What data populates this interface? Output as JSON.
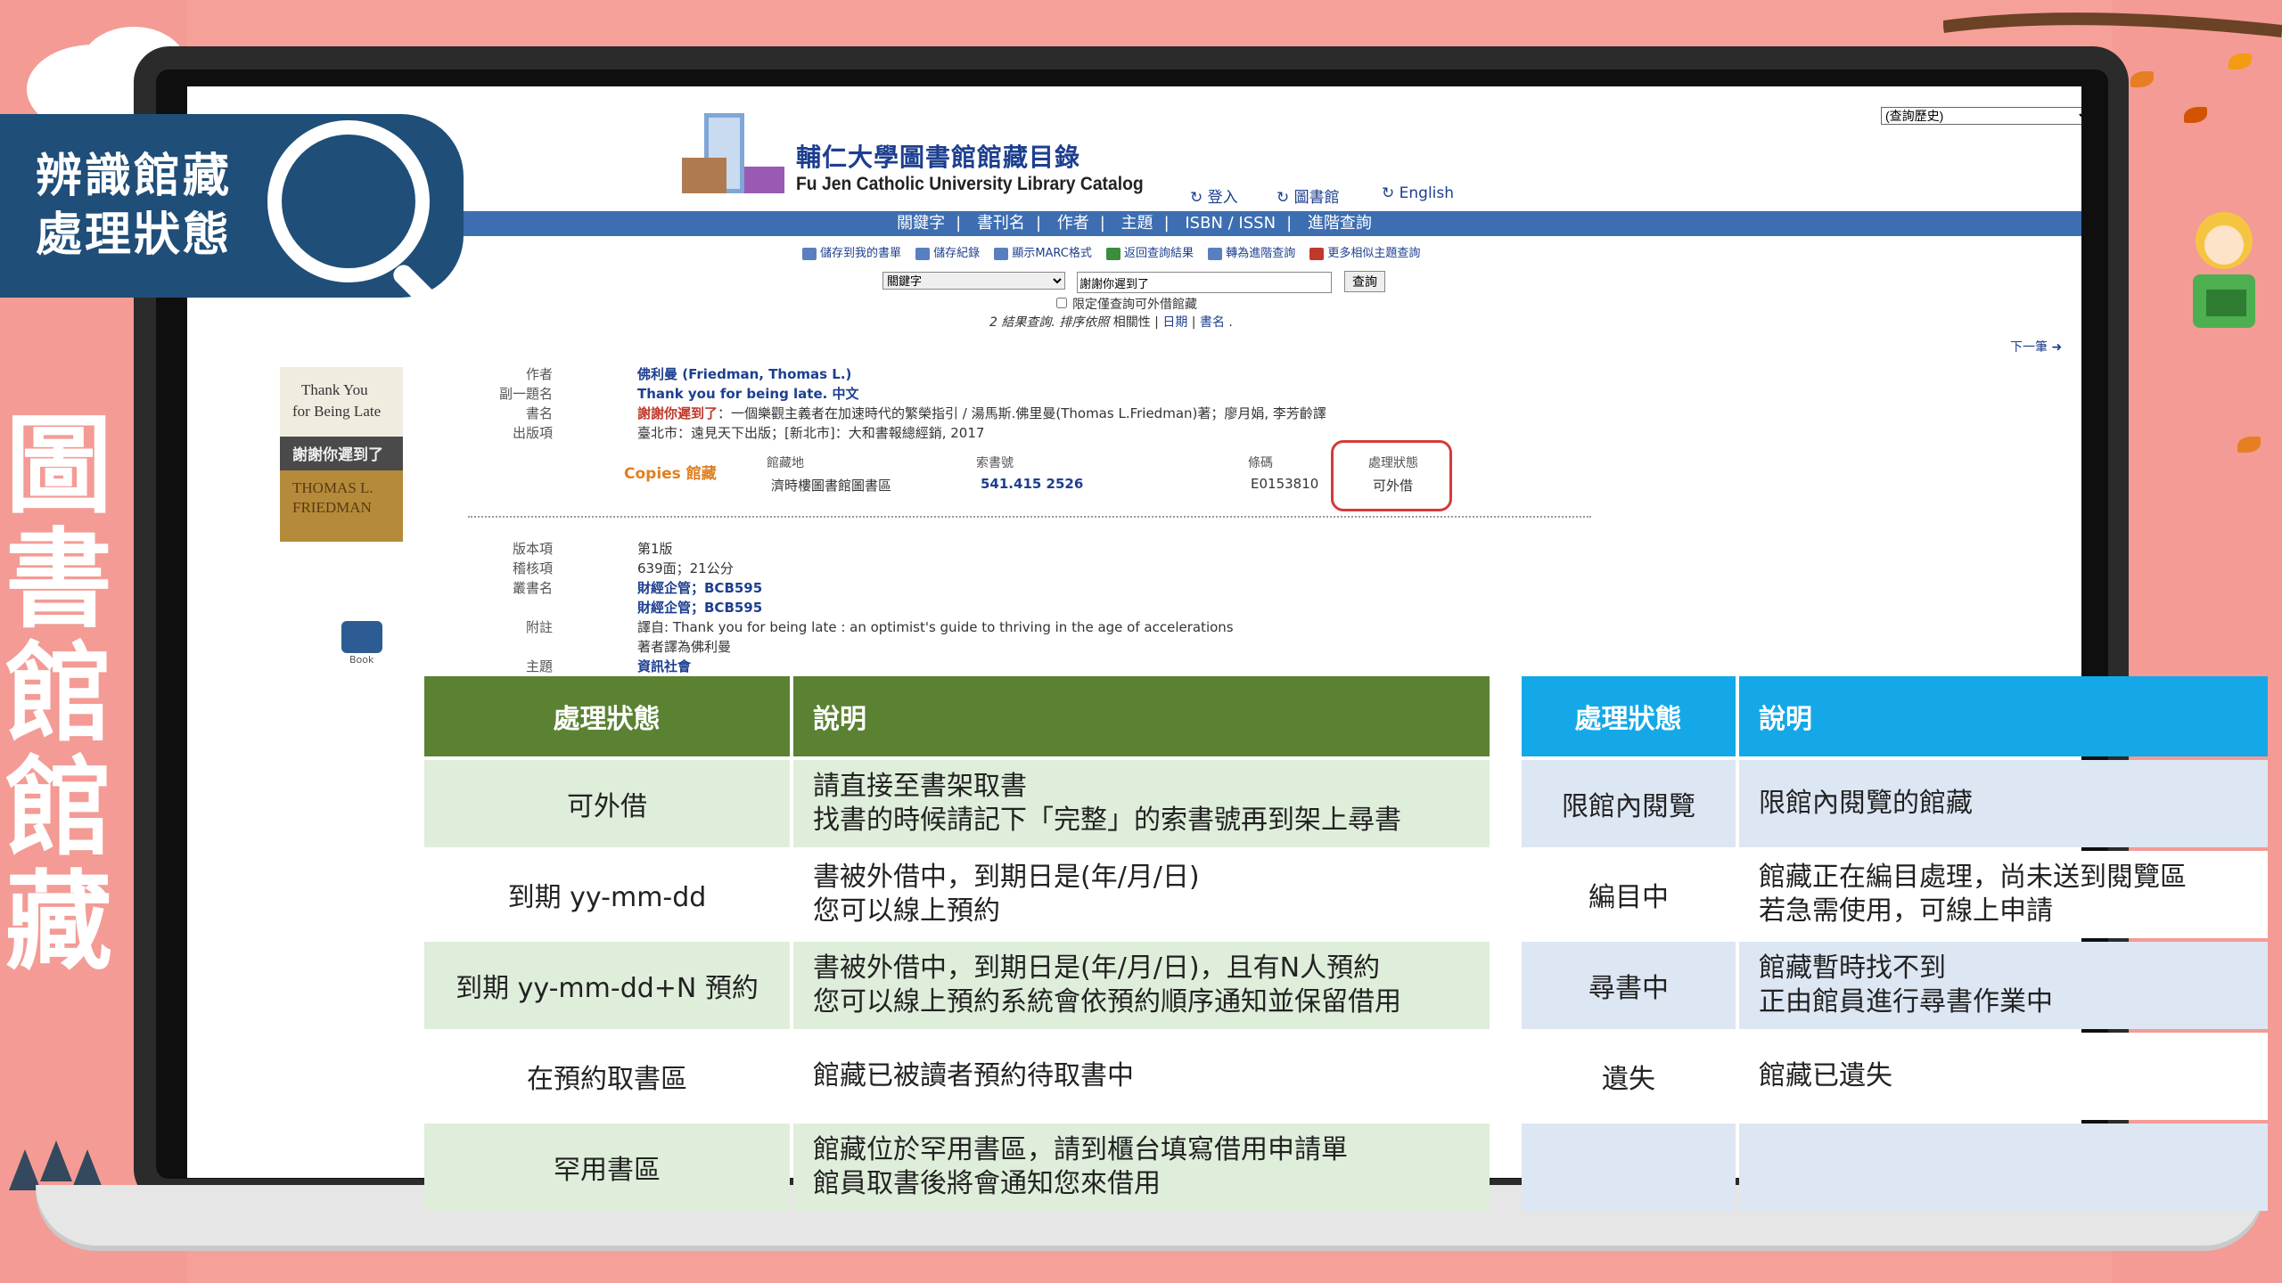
{
  "overlay": {
    "badge_line1": "辨識館藏",
    "badge_line2": "處理狀態",
    "side_title": "圖書館館藏"
  },
  "catalog": {
    "history_select": "(查詢歷史)",
    "logo_title": "輔仁大學圖書館館藏目錄",
    "logo_subtitle": "Fu Jen Catholic University Library Catalog",
    "top_links": [
      "↻ 登入",
      "↻ 圖書館",
      "↻ English"
    ],
    "nav": [
      "關鍵字",
      "書刊名",
      "作者",
      "主題",
      "ISBN / ISSN",
      "進階查詢"
    ],
    "toolbar": [
      "儲存到我的書單",
      "儲存紀錄",
      "顯示MARC格式",
      "返回查詢結果",
      "轉為進階查詢",
      "更多相似主題查詢"
    ],
    "search_field": "關鍵字",
    "search_value": "謝謝你遲到了",
    "search_button": "查詢",
    "limit_label": "限定僅查詢可外借館藏",
    "sort_prefix": "2 結果查詢. 排序依照",
    "sort_options": [
      "相關性",
      "日期",
      "書名"
    ],
    "next_link": "下一筆",
    "record": {
      "author_label": "作者",
      "author": "佛利曼 (Friedman, Thomas L.)",
      "alt_title_label": "副一題名",
      "alt_title": "Thank you for being late. 中文",
      "title_label": "書名",
      "title_main": "謝謝你遲到了",
      "title_rest": "：一個樂觀主義者在加速時代的繁榮指引 / 湯馬斯.佛里曼(Thomas L.Friedman)著；廖月娟, 李芳齡譯",
      "pub_label": "出版項",
      "pub": "臺北市：遠見天下出版；[新北市]：大和書報總經銷, 2017",
      "copies_label": "Copies 館藏",
      "col_location": "館藏地",
      "col_callno": "索書號",
      "col_barcode": "條碼",
      "col_status": "處理狀態",
      "location": "濟時樓圖書館圖書區",
      "callno": "541.415 2526",
      "barcode": "E0153810",
      "status": "可外借",
      "edition_label": "版本項",
      "edition": "第1版",
      "format_label": "稽核項",
      "format": "639面；21公分",
      "series_label": "叢書名",
      "series1": "財經企管；BCB595",
      "series2": "財經企管；BCB595",
      "note_label": "附註",
      "note1": "譯自: Thank you for being late : an optimist's guide to thriving in the age of accelerations",
      "note2": "著者譯為佛利曼",
      "subject_label": "主題",
      "subject": "資訊社會",
      "book_type": "Book"
    },
    "cover": {
      "line1": "Thank You",
      "line2": "for Being Late",
      "line3": "謝謝你遲到了",
      "line4": "THOMAS L.",
      "line5": "FRIEDMAN"
    }
  },
  "status_table_left": {
    "header": [
      "處理狀態",
      "說明"
    ],
    "rows": [
      {
        "status": "可外借",
        "desc1": "請直接至書架取書",
        "desc2": "找書的時候請記下「完整」的索書號再到架上尋書"
      },
      {
        "status": "到期 yy-mm-dd",
        "desc1": "書被外借中，到期日是(年/月/日)",
        "desc2": "您可以線上預約"
      },
      {
        "status": "到期 yy-mm-dd+N 預約",
        "desc1": "書被外借中，到期日是(年/月/日)，且有N人預約",
        "desc2": "您可以線上預約系統會依預約順序通知並保留借用"
      },
      {
        "status": "在預約取書區",
        "desc1": "館藏已被讀者預約待取書中",
        "desc2": ""
      },
      {
        "status": "罕用書區",
        "desc1": "館藏位於罕用書區，請到櫃台填寫借用申請單",
        "desc2": "館員取書後將會通知您來借用"
      }
    ]
  },
  "status_table_right": {
    "header": [
      "處理狀態",
      "說明"
    ],
    "rows": [
      {
        "status": "限館內閱覽",
        "desc1": "限館內閱覽的館藏",
        "desc2": ""
      },
      {
        "status": "編目中",
        "desc1": "館藏正在編目處理，尚未送到閱覽區",
        "desc2": "若急需使用，可線上申請"
      },
      {
        "status": "尋書中",
        "desc1": "館藏暫時找不到",
        "desc2": "正由館員進行尋書作業中"
      },
      {
        "status": "遺失",
        "desc1": "館藏已遺失",
        "desc2": ""
      },
      {
        "status": "",
        "desc1": "",
        "desc2": ""
      }
    ]
  },
  "colors": {
    "green_header": "#5a8232",
    "green_row": "#dfeeda",
    "blue_header": "#14a8e8",
    "blue_row": "#dde6f3",
    "badge": "#1f4e79",
    "background": "#f6a09a",
    "status_highlight": "#d23b3b"
  }
}
